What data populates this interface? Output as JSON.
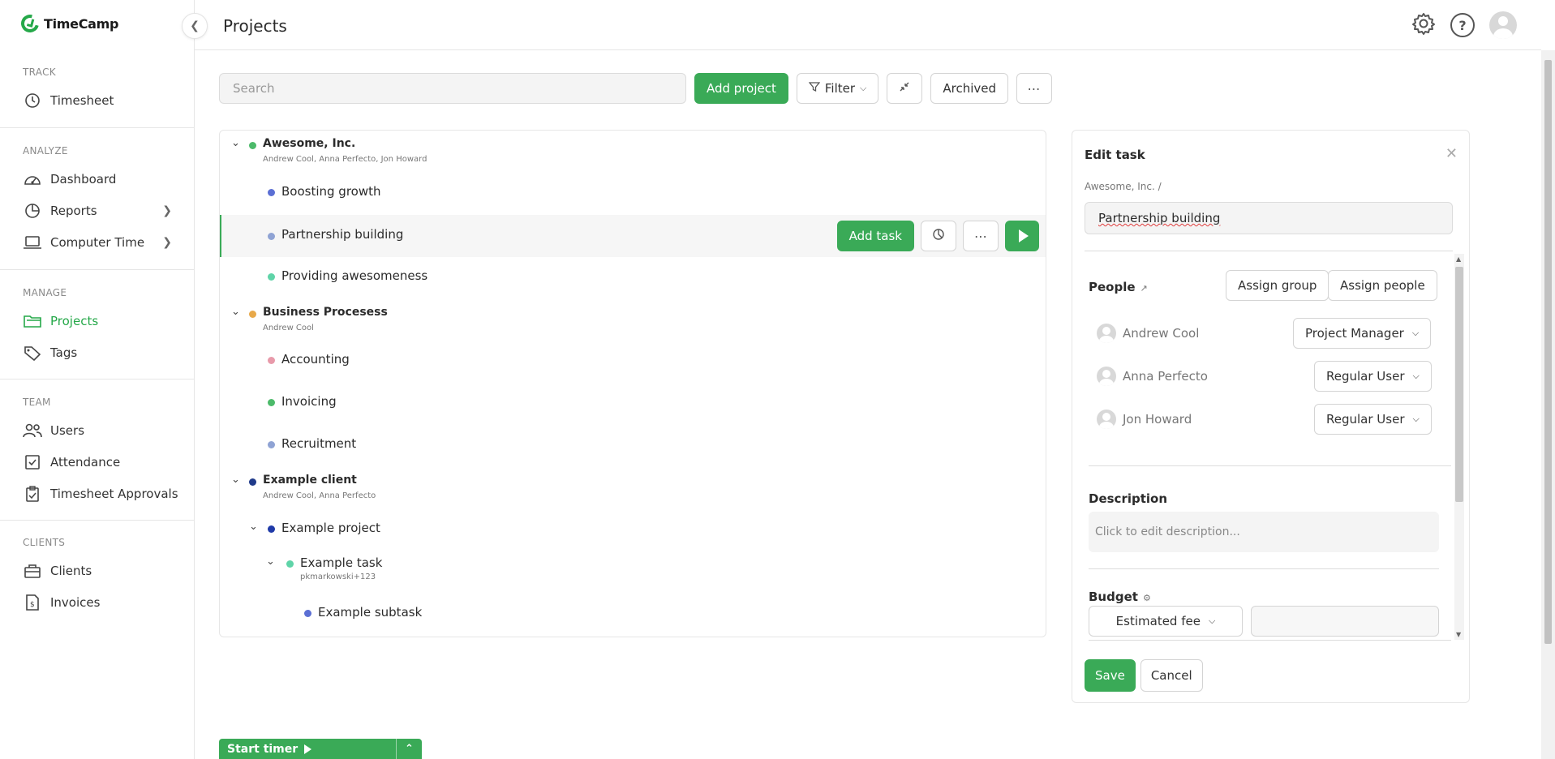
{
  "app": {
    "name": "TimeCamp"
  },
  "sidebar": {
    "sections": [
      {
        "heading": "TRACK",
        "items": [
          {
            "label": "Timesheet",
            "icon": "clock-icon"
          }
        ]
      },
      {
        "heading": "ANALYZE",
        "items": [
          {
            "label": "Dashboard",
            "icon": "dashboard-icon"
          },
          {
            "label": "Reports",
            "icon": "pie-chart-icon"
          },
          {
            "label": "Computer Time",
            "icon": "laptop-icon"
          }
        ]
      },
      {
        "heading": "MANAGE",
        "items": [
          {
            "label": "Projects",
            "icon": "folder-icon",
            "active": true
          },
          {
            "label": "Tags",
            "icon": "tag-icon"
          }
        ]
      },
      {
        "heading": "TEAM",
        "items": [
          {
            "label": "Users",
            "icon": "users-icon"
          },
          {
            "label": "Attendance",
            "icon": "checkbox-icon"
          },
          {
            "label": "Timesheet Approvals",
            "icon": "clipboard-icon"
          }
        ]
      },
      {
        "heading": "CLIENTS",
        "items": [
          {
            "label": "Clients",
            "icon": "briefcase-icon"
          },
          {
            "label": "Invoices",
            "icon": "invoice-icon"
          }
        ]
      }
    ]
  },
  "header": {
    "title": "Projects"
  },
  "toolbar": {
    "search_placeholder": "Search",
    "add_project": "Add project",
    "filter": "Filter",
    "archived": "Archived"
  },
  "projects": {
    "awesome": {
      "name": "Awesome, Inc.",
      "people": "Andrew Cool, Anna Perfecto, Jon Howard",
      "color": "#4cba6a"
    },
    "boosting": {
      "name": "Boosting growth",
      "color": "#5b6fd4"
    },
    "partnership": {
      "name": "Partnership building",
      "color": "#8fa3d4"
    },
    "providing": {
      "name": "Providing awesomeness",
      "color": "#5fd4a8"
    },
    "business": {
      "name": "Business Procesess",
      "people": "Andrew Cool",
      "color": "#e8a94a"
    },
    "accounting": {
      "name": "Accounting",
      "color": "#e89aaa"
    },
    "invoicing": {
      "name": "Invoicing",
      "color": "#4cba6a"
    },
    "recruitment": {
      "name": "Recruitment",
      "color": "#8fa3d4"
    },
    "example_client": {
      "name": "Example client",
      "people": "Andrew Cool, Anna Perfecto",
      "color": "#1f3a8a"
    },
    "example_project": {
      "name": "Example project",
      "color": "#1f3aa8"
    },
    "example_task": {
      "name": "Example task",
      "user": "pkmarkowski+123",
      "color": "#5fd4a8"
    },
    "example_subtask": {
      "name": "Example subtask",
      "color": "#5b6fd4"
    }
  },
  "row_actions": {
    "add_task": "Add task"
  },
  "edit_task": {
    "title": "Edit task",
    "breadcrumb": "Awesome, Inc. /",
    "task_name": "Partnership building",
    "people_label": "People",
    "assign_group": "Assign group",
    "assign_people": "Assign people",
    "people": [
      {
        "name": "Andrew Cool",
        "role": "Project Manager"
      },
      {
        "name": "Anna Perfecto",
        "role": "Regular User"
      },
      {
        "name": "Jon Howard",
        "role": "Regular User"
      }
    ],
    "description_label": "Description",
    "description_placeholder": "Click to edit description...",
    "budget_label": "Budget",
    "budget_type": "Estimated fee",
    "budget_value": "",
    "save": "Save",
    "cancel": "Cancel"
  },
  "timer": {
    "label": "Start timer"
  },
  "colors": {
    "accent": "#3aaa57"
  }
}
